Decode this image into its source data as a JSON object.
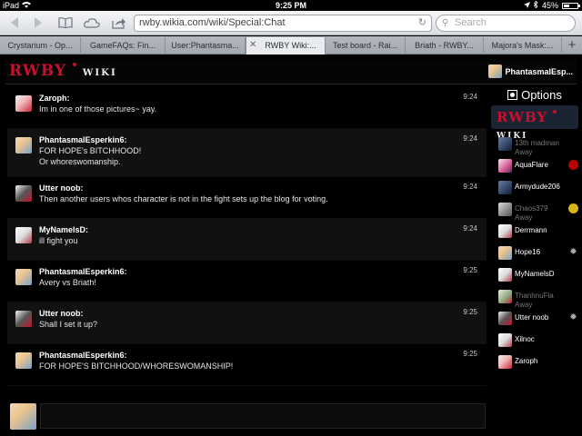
{
  "status_bar": {
    "device": "iPad",
    "time": "9:25 PM",
    "battery_percent": "45%",
    "battery_level": 0.45
  },
  "nav": {
    "url": "rwby.wikia.com/wiki/Special:Chat",
    "search_placeholder": "Search"
  },
  "tabs": [
    {
      "label": "Crystarium - Op...",
      "active": false
    },
    {
      "label": "GameFAQs: Fin...",
      "active": false
    },
    {
      "label": "User:Phantasma...",
      "active": false
    },
    {
      "label": "RWBY Wiki:...",
      "active": true
    },
    {
      "label": "Test board - Rai...",
      "active": false
    },
    {
      "label": "Briath - RWBY...",
      "active": false
    },
    {
      "label": "Majora's Mask:...",
      "active": false
    }
  ],
  "wiki": {
    "logo_word": "RWBY",
    "logo_sub": "WIKI",
    "current_user": "PhantasmalEsp..."
  },
  "messages": [
    {
      "author": "Zaroph:",
      "lines": [
        "Im in one of those pictures~ yay."
      ],
      "time": "9:24",
      "avatar": "red"
    },
    {
      "author": "PhantasmalEsperkin6:",
      "lines": [
        "FOR HOPE's BITCHHOOD!",
        "Or whoreswomanship."
      ],
      "time": "9:24",
      "avatar": "blonde"
    },
    {
      "author": "Utter noob:",
      "lines": [
        "Then another users whos character is not in the fight sets up the blog for voting."
      ],
      "time": "9:24",
      "avatar": "dark"
    },
    {
      "author": "MyNamelsD:",
      "lines": [
        "ill fight you"
      ],
      "time": "9:24",
      "avatar": "white"
    },
    {
      "author": "PhantasmalEsperkin6:",
      "lines": [
        "Avery vs Briath!"
      ],
      "time": "9:25",
      "avatar": "blonde"
    },
    {
      "author": "Utter noob:",
      "lines": [
        "Shall I set it up?"
      ],
      "time": "9:25",
      "avatar": "dark"
    },
    {
      "author": "PhantasmalEsperkin6:",
      "lines": [
        "FOR HOPE'S BITCHHOOD/WHORESWOMANSHIP!"
      ],
      "time": "9:25",
      "avatar": "blonde"
    }
  ],
  "sidebar": {
    "options_label": "Options",
    "users": [
      {
        "name": "13th madman",
        "status": "Away",
        "avatar": "navy",
        "badge": ""
      },
      {
        "name": "AquaFlare",
        "status": "",
        "avatar": "pink",
        "badge": "red"
      },
      {
        "name": "Armydude206",
        "status": "",
        "avatar": "navy",
        "badge": ""
      },
      {
        "name": "Chaos379",
        "status": "Away",
        "avatar": "grey",
        "badge": "gold"
      },
      {
        "name": "Derrmann",
        "status": "",
        "avatar": "white",
        "badge": ""
      },
      {
        "name": "Hope16",
        "status": "",
        "avatar": "blonde",
        "badge": "star"
      },
      {
        "name": "MyNamelsD",
        "status": "",
        "avatar": "white",
        "badge": ""
      },
      {
        "name": "ThanhnuFla",
        "status": "Away",
        "avatar": "green",
        "badge": ""
      },
      {
        "name": "Utter noob",
        "status": "",
        "avatar": "dark",
        "badge": "star"
      },
      {
        "name": "Xilnoc",
        "status": "",
        "avatar": "white",
        "badge": ""
      },
      {
        "name": "Zaroph",
        "status": "",
        "avatar": "red",
        "badge": ""
      }
    ]
  },
  "icons": {
    "back": "back-arrow-icon",
    "forward": "forward-arrow-icon",
    "bookmarks": "book-icon",
    "cloud": "cloud-icon",
    "share": "share-icon",
    "reload": "reload-icon",
    "search": "search-icon",
    "wifi": "wifi-icon",
    "location": "location-arrow-icon",
    "bluetooth": "bluetooth-icon",
    "options": "options-gear-icon",
    "new_tab": "plus-icon",
    "close_tab": "close-icon"
  },
  "colors": {
    "page_bg": "#000000",
    "alt_row": "#111111",
    "logo_red": "#c8102e",
    "logo_gold": "#f3d200"
  }
}
